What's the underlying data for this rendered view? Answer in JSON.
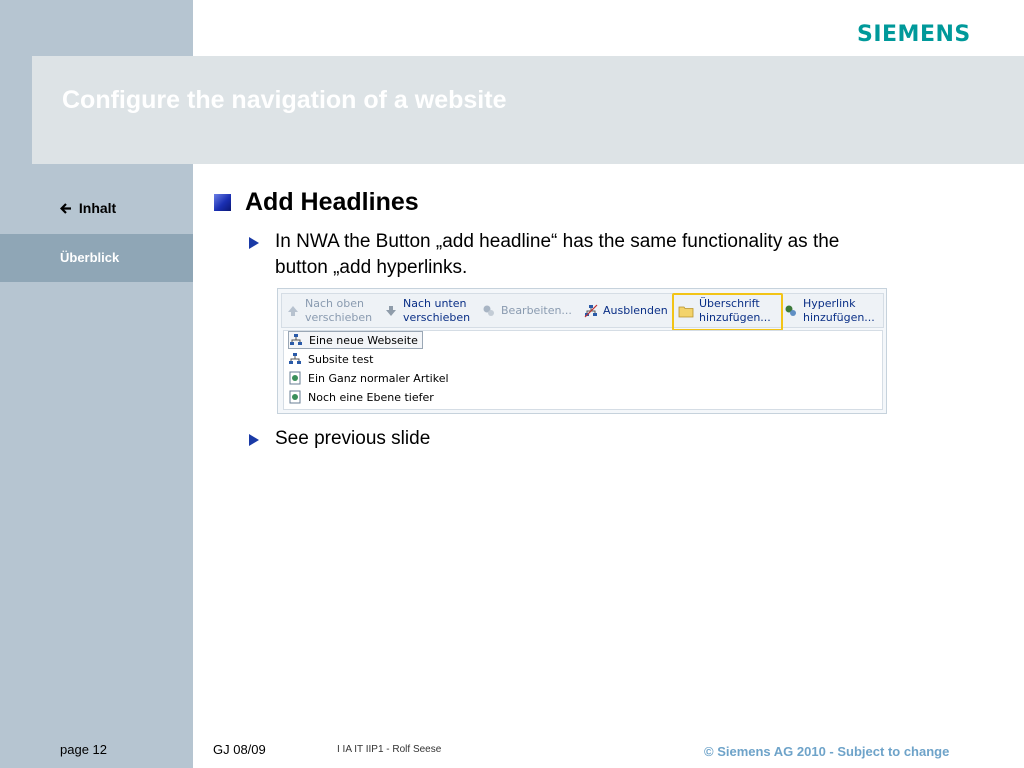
{
  "brand": {
    "logo_text": "SIEMENS",
    "logo_color": "#00999a"
  },
  "slide": {
    "title": "Configure the navigation of a website"
  },
  "nav": {
    "back_label": "Inhalt",
    "back_icon": "arrow-left-icon",
    "current_section": "Überblick"
  },
  "content": {
    "headline": "Add Headlines",
    "bullets": [
      {
        "text_line1": "In NWA the Button „add headline“ has the same functionality as the",
        "text_line2": "button „add hyperlinks."
      },
      {
        "text": "See previous slide"
      }
    ]
  },
  "screenshot": {
    "toolbar": [
      {
        "line1": "Nach oben",
        "line2": "verschieben",
        "icon": "arrow-up-icon",
        "state": "disabled"
      },
      {
        "line1": "Nach unten",
        "line2": "verschieben",
        "icon": "arrow-down-icon",
        "state": "enabled"
      },
      {
        "line1": "Bearbeiten...",
        "icon": "edit-icon",
        "state": "disabled"
      },
      {
        "line1": "Ausblenden",
        "icon": "hide-icon",
        "state": "enabled"
      },
      {
        "line1": "Überschrift",
        "line2": "hinzufügen...",
        "icon": "folder-icon",
        "state": "enabled",
        "highlighted": true
      },
      {
        "line1": "Hyperlink",
        "line2": "hinzufügen...",
        "icon": "hyperlink-icon",
        "state": "enabled"
      }
    ],
    "tree": [
      {
        "label": "Eine neue Webseite",
        "icon": "sitemap-icon",
        "selected": true
      },
      {
        "label": "Subsite test",
        "icon": "sitemap-icon"
      },
      {
        "label": "Ein Ganz normaler Artikel",
        "icon": "article-icon"
      },
      {
        "label": "Noch eine Ebene tiefer",
        "icon": "article-icon"
      }
    ],
    "highlight_color": "#f2c417"
  },
  "footer": {
    "page": "page 12",
    "version": "GJ 08/09",
    "department": "I IA IT IIP1 - Rolf Seese",
    "copyright": "© Siemens AG 2010  -  Subject to change"
  }
}
